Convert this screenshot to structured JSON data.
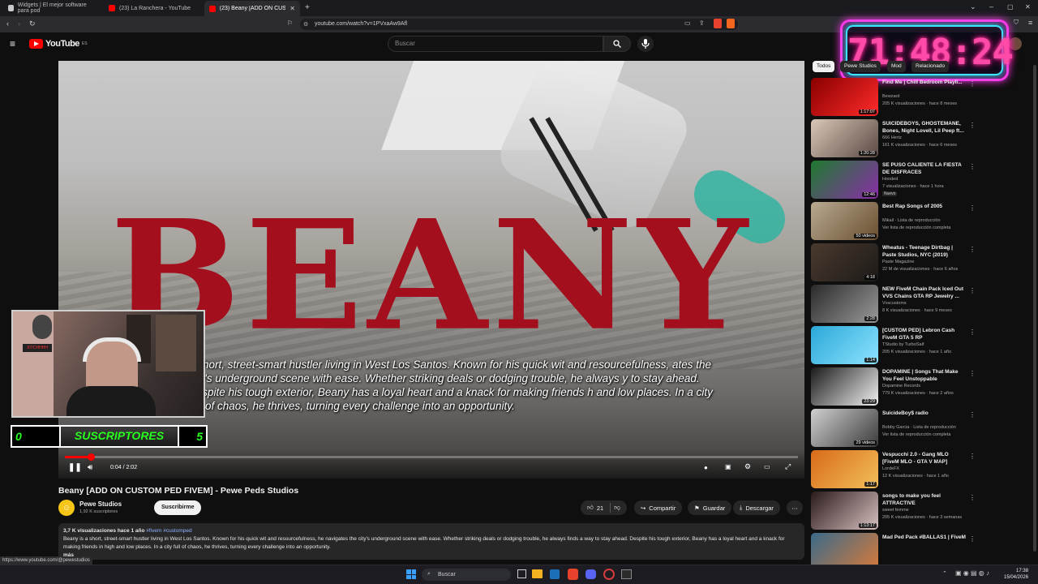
{
  "browser": {
    "tabs": [
      {
        "label": "Widgets | El mejor software para pod",
        "fav_color": "#c9c9c9"
      },
      {
        "label": "(23) La Ranchera - YouTube",
        "fav_color": "#ff0000"
      },
      {
        "label": "(23) Beany [ADD ON CUSTOM",
        "fav_color": "#ff0000",
        "active": true
      }
    ],
    "url": "youtube.com/watch?v=1PVxaAw9Afl",
    "status_url": "https://www.youtube.com/@pewestudios"
  },
  "youtube": {
    "logo_text": "YouTube",
    "logo_suffix": "ES",
    "search_placeholder": "Buscar"
  },
  "player": {
    "title_overlay": "BEANY",
    "caption": "n short, street-smart hustler living in West Los Santos. Known for his quick wit and resourcefulness, ates the city's underground scene with ease. Whether striking deals or dodging trouble, he always y to stay ahead. Despite his tough exterior, Beany has a loyal heart and a knack for making friends h and low places. In a city full of chaos, he thrives, turning every challenge into an opportunity.",
    "time": "0:04 / 2:02",
    "progress": 0.033
  },
  "overlay": {
    "timer": "71:48:24",
    "subscribers_label": "SUSCRIPTORES",
    "subs_left": "0",
    "subs_right": "5",
    "cam_sign": "XITCHHHH"
  },
  "video": {
    "title": "Beany [ADD ON CUSTOM PED FIVEM] - Pewe Peds Studios",
    "channel": "Pewe Studios",
    "subscribers": "1,92 K suscriptores",
    "subscribe_label": "Suscribirme",
    "likes": "21",
    "share_label": "Compartir",
    "save_label": "Guardar",
    "download_label": "Descargar",
    "views_meta": "3,7 K visualizaciones  hace 1 año",
    "tags": "#fivem #customped",
    "description": "Beany is a short, street-smart hustler living in West Los Santos. Known for his quick wit and resourcefulness, he navigates the city's underground scene with ease. Whether striking deals or dodging trouble, he always finds a way to stay ahead. Despite his tough exterior, Beany has a loyal heart and a knack for making friends in high and low places. In a city full of chaos, he thrives, turning every challenge into an opportunity.",
    "more_label": "más"
  },
  "chips": [
    "Todos",
    "Pewe Studios",
    "Mod",
    "Relacionado"
  ],
  "recommendations": [
    {
      "title": "Find Me | Chill Bedroom Playli...",
      "channel": "Bewzard",
      "meta": "205 K visualizaciones · hace 8 meses",
      "duration": "1:17:07",
      "color1": "#8a0000",
      "color2": "#ff2a2a"
    },
    {
      "title": "SUICIDEBOYS, GHOSTEMANE, Bones, Night Lovell, Lil Peep ft...",
      "channel": "666 Hertz",
      "meta": "161 K visualizaciones · hace 6 meses",
      "duration": "1:20:28",
      "color1": "#d9c8b8",
      "color2": "#5a4a44"
    },
    {
      "title": "SE PUSO CALIENTE LA FIESTA DE DISFRACES",
      "channel": "Hooded",
      "meta": "7 visualizaciones · hace 1 hora",
      "duration": "12:46",
      "badge": "Nuevo",
      "color1": "#1e7a2e",
      "color2": "#8a2ea8"
    },
    {
      "title": "Best Rap Songs of 2005",
      "channel": "Mikail · Lista de reproducción",
      "meta": "Ver lista de reproducción completa",
      "duration": "50 videos",
      "color1": "#b8aa90",
      "color2": "#6a4e30"
    },
    {
      "title": "Wheatus - Teenage Dirtbag | Paste Studios, NYC (2019)",
      "channel": "Paste Magazine",
      "meta": "22 M de visualizaciones · hace 6 años",
      "duration": "4:18",
      "color1": "#4a3a2e",
      "color2": "#1c1a18"
    },
    {
      "title": "NEW FiveM Chain Pack Iced Out VVS Chains GTA RP Jewelry ...",
      "channel": "Vvscustoms",
      "meta": "8 K visualizaciones · hace 9 meses",
      "duration": "2:28",
      "color1": "#2a2a2a",
      "color2": "#9a9a9a"
    },
    {
      "title": "[CUSTOM PED] Lebron Cash FiveM GTA 5 RP",
      "channel": "TStudio by TurboSaif",
      "meta": "205 K visualizaciones · hace 1 año",
      "duration": "1:14",
      "color1": "#2aa8d8",
      "color2": "#8fe3ff"
    },
    {
      "title": "DOPAMINE | Songs That Make You Feel Unstoppable",
      "channel": "Dopamine Records",
      "meta": "779 K visualizaciones · hace 2 años",
      "duration": "23:29",
      "color1": "#1a1a1a",
      "color2": "#f2f2f2"
    },
    {
      "title": "SuicideBoy$ radio",
      "channel": "Bobby Garcia · Lista de reproducción",
      "meta": "Ver lista de reproducción completa",
      "duration": "29 videos",
      "color1": "#d0d0d0",
      "color2": "#3a3a3a"
    },
    {
      "title": "Vespucchi 2.0 - Gang MLO [FiveM MLO - GTA V MAP]",
      "channel": "LordeFX",
      "meta": "12 K visualizaciones · hace 1 año",
      "duration": "1:17",
      "color1": "#d86a1a",
      "color2": "#f2c05a"
    },
    {
      "title": "songs to make you feel ATTRACTIVE",
      "channel": "sweet femme",
      "meta": "205 K visualizaciones · hace 3 semanas",
      "duration": "1:13:17",
      "color1": "#2a1a1a",
      "color2": "#d8c0c0"
    },
    {
      "title": "Mad Ped Pack #BALLAS1 | FiveM",
      "channel": "",
      "meta": "",
      "duration": "",
      "color1": "#3a6a8a",
      "color2": "#d87a3a"
    }
  ],
  "taskbar": {
    "search_placeholder": "Buscar",
    "time": "17:38",
    "date": "15/04/2026"
  }
}
